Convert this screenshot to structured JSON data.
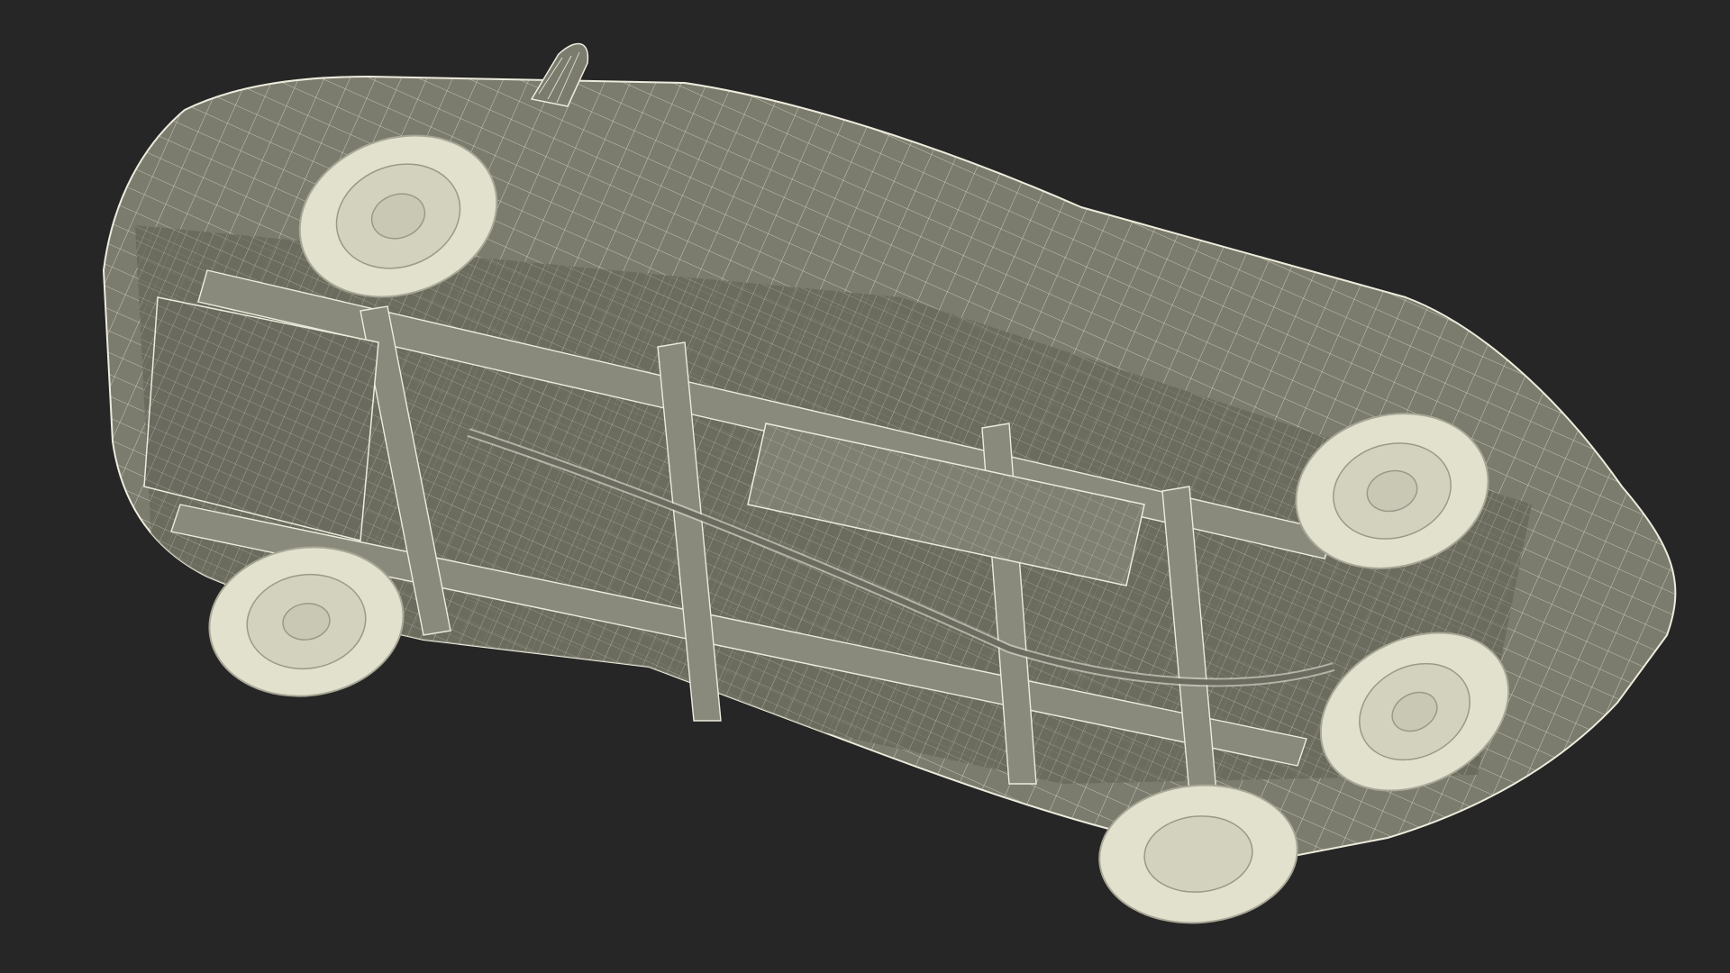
{
  "scene": {
    "subject": "car-underside-wireframe",
    "background_color": "#262626",
    "body_color": "#7b7b6e",
    "body_shade_color": "#65655a",
    "wire_color": "#ecebdc",
    "tire_color": "#e2e1cd",
    "rim_color": "#c9c8b5"
  }
}
